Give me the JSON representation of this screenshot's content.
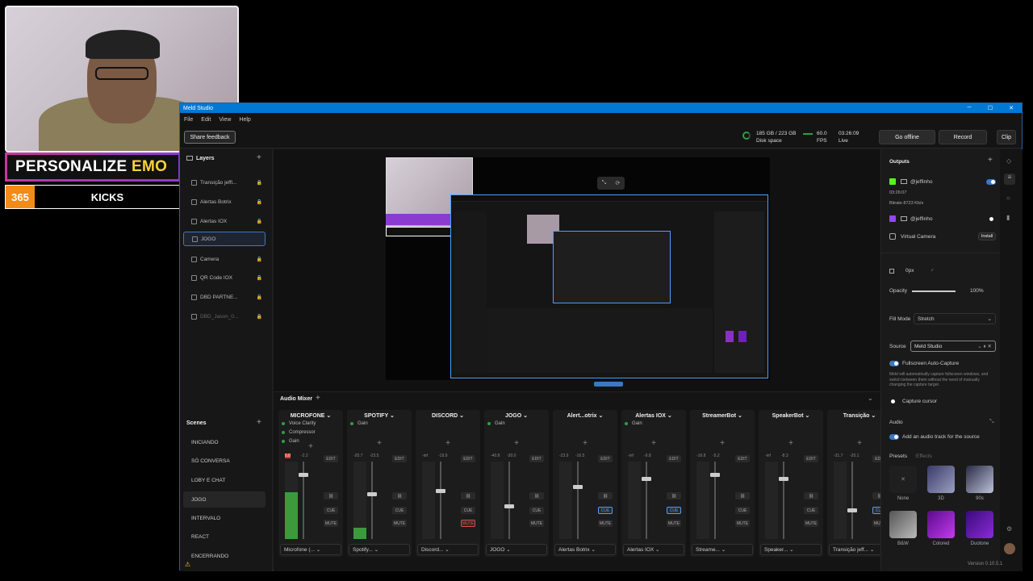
{
  "overlay": {
    "banner_text_a": "PERSONALIZE",
    "banner_text_b": "EMO",
    "counter_number": "365",
    "counter_text": "KICKS"
  },
  "window": {
    "title": "Meld Studio",
    "menu": [
      "File",
      "Edit",
      "View",
      "Help"
    ],
    "toolbar": {
      "feedback": "Share feedback",
      "disk_value": "185 GB / 223 GB",
      "disk_label": "Disk space",
      "fps_value": "60.0",
      "fps_label": "FPS",
      "live_time": "03:26:09",
      "live_label": "Live",
      "go_offline": "Go offline",
      "record": "Record",
      "clip": "Clip"
    }
  },
  "layers": {
    "title": "Layers",
    "items": [
      "Transição jeffi...",
      "Alertas Botrix",
      "Alertas IOX",
      "JOGO",
      "Camera",
      "QR Code IOX",
      "DBD PARTNE...",
      "DBD_Jason_0..."
    ]
  },
  "scenes": {
    "title": "Scenes",
    "items": [
      "INICIANDO",
      "SÓ CONVERSA",
      "LOBY E CHAT",
      "JOGO",
      "INTERVALO",
      "REACT",
      "ENCERRANDO"
    ]
  },
  "mixer": {
    "title": "Audio Mixer",
    "channels": [
      {
        "name": "MICROFONE",
        "src": "Microfone (...",
        "v1": "0.0",
        "v2": "-2.2",
        "fill": 0.6,
        "pos": 0.15,
        "cue": false,
        "mute": false,
        "fx": [
          "Voice Clarity",
          "Compressor",
          "Gain"
        ]
      },
      {
        "name": "SPOTIFY",
        "src": "Spotify...",
        "v1": "-20.7",
        "v2": "-23.5",
        "fill": 0.15,
        "pos": 0.4,
        "cue": false,
        "mute": false,
        "fx": [
          "Gain"
        ]
      },
      {
        "name": "DISCORD",
        "src": "Discord...",
        "v1": "-inf",
        "v2": "-19.9",
        "fill": 0,
        "pos": 0.35,
        "cue": false,
        "mute": true,
        "fx": []
      },
      {
        "name": "JOGO",
        "src": "JOGO",
        "v1": "-40.8",
        "v2": "-30.0",
        "fill": 0,
        "pos": 0.55,
        "cue": false,
        "mute": false,
        "fx": [
          "Gain"
        ]
      },
      {
        "name": "Alert...otrix",
        "src": "Alertas Botrix",
        "v1": "-23.9",
        "v2": "-16.5",
        "fill": 0,
        "pos": 0.3,
        "cue": true,
        "mute": false,
        "fx": []
      },
      {
        "name": "Alertas IOX",
        "src": "Alertas IOX",
        "v1": "-inf",
        "v2": "-9.8",
        "fill": 0,
        "pos": 0.2,
        "cue": true,
        "mute": false,
        "fx": [
          "Gain"
        ]
      },
      {
        "name": "StreamerBot",
        "src": "Streame...",
        "v1": "-16.8",
        "v2": "-5.2",
        "fill": 0,
        "pos": 0.15,
        "cue": false,
        "mute": false,
        "fx": []
      },
      {
        "name": "SpeakerBot",
        "src": "Speaker...",
        "v1": "-inf",
        "v2": "-8.3",
        "fill": 0,
        "pos": 0.2,
        "cue": false,
        "mute": false,
        "fx": []
      },
      {
        "name": "Transição",
        "src": "Transição jeff...",
        "v1": "-31.7",
        "v2": "-20.1",
        "fill": 0,
        "pos": 0.6,
        "cue": true,
        "mute": false,
        "fx": []
      }
    ],
    "edit": "EDIT",
    "cue": "CUE",
    "mute": "MUTE"
  },
  "outputs": {
    "title": "Outputs",
    "kick_name": "@jeffinho",
    "kick_time": "03:26:07",
    "kick_bitrate": "Bitrate  8723 Kb/s",
    "twitch_name": "@jeffinho",
    "virtual_camera": "Virtual Camera",
    "install": "Install"
  },
  "properties": {
    "px": "0px",
    "opacity_label": "Opacity",
    "opacity_value": "100%",
    "opacity_level": 1.0,
    "fill_mode_label": "Fill Mode",
    "fill_mode_value": "Stretch",
    "source_label": "Source",
    "source_value": "Meld Studio",
    "fullscreen_label": "Fullscreen Auto-Capture",
    "fullscreen_desc": "Meld will automatically capture fullscreen windows, and switch between them without the need of manually changing the capture target.",
    "cursor_label": "Capture cursor",
    "audio_title": "Audio",
    "audio_track": "Add an audio track for the source",
    "presets_tab": "Presets",
    "effects_tab": "Effects",
    "presets": [
      "None",
      "3D",
      "90s",
      "B&W",
      "Colored",
      "Duotone"
    ]
  },
  "version": "Version 0.10.5.1"
}
